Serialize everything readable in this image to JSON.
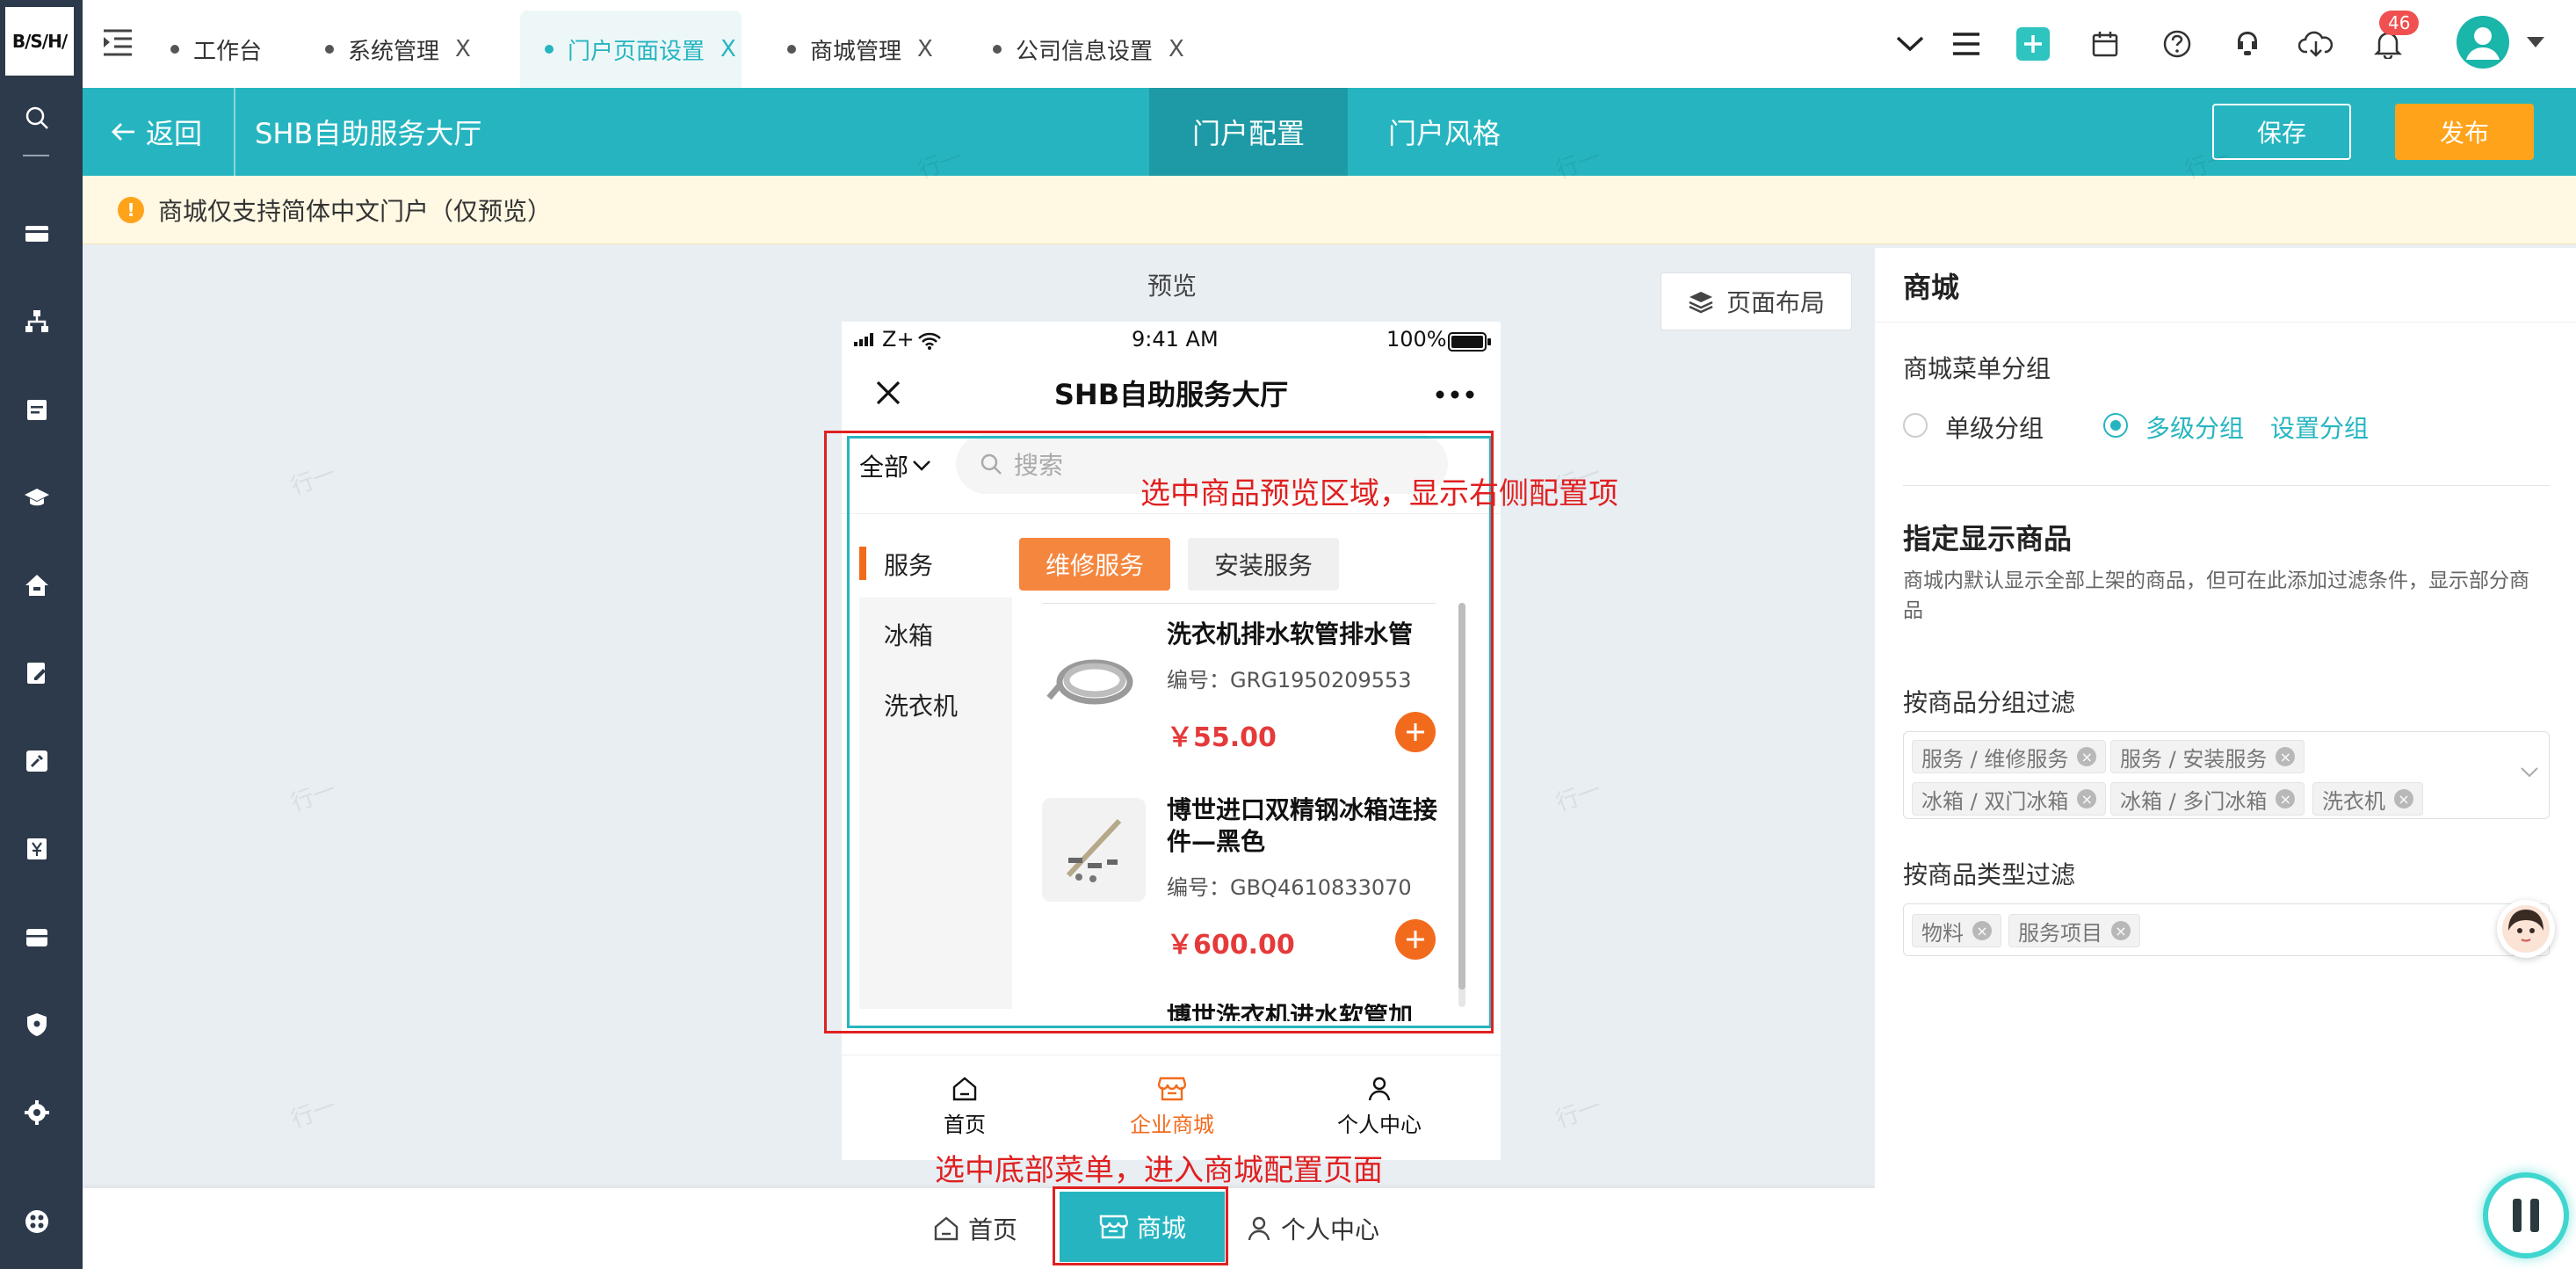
{
  "brand": {
    "logo_text": "B/S/H/"
  },
  "tabs": [
    {
      "label": "工作台",
      "closable": false,
      "active": false
    },
    {
      "label": "系统管理",
      "closable": true,
      "active": false
    },
    {
      "label": "门户页面设置",
      "closable": true,
      "active": true
    },
    {
      "label": "商城管理",
      "closable": true,
      "active": false
    },
    {
      "label": "公司信息设置",
      "closable": true,
      "active": false
    }
  ],
  "tab_close_glyph": "X",
  "topbar": {
    "notification_count": "46"
  },
  "header": {
    "back_label": "返回",
    "portal_name": "SHB自助服务大厅",
    "center_tabs": [
      "门户配置",
      "门户风格"
    ],
    "save_label": "保存",
    "publish_label": "发布"
  },
  "notice": {
    "text": "商城仅支持简体中文门户（仅预览）"
  },
  "preview": {
    "label": "预览",
    "layout_button": "页面布局",
    "status_bar": {
      "carrier": "Z+",
      "time": "9:41 AM",
      "battery": "100%"
    },
    "title": "SHB自助服务大厅",
    "category_all": "全部",
    "search_placeholder": "搜索",
    "side_menu": [
      "服务",
      "冰箱",
      "洗衣机"
    ],
    "pills": [
      "维修服务",
      "安装服务"
    ],
    "products": [
      {
        "name": "洗衣机排水软管排水管",
        "code": "编号：GRG1950209553",
        "price": "￥55.00"
      },
      {
        "name": "博世进口双精钢冰箱连接件—黑色",
        "code": "编号：GBQ4610833070",
        "price": "￥600.00"
      },
      {
        "name": "博世洗衣机进水软管加",
        "code": "",
        "price": ""
      }
    ],
    "tabbar": [
      "首页",
      "企业商城",
      "个人中心"
    ]
  },
  "annotations": {
    "goods_area": "选中商品预览区域，显示右侧配置项",
    "bottom_menu": "选中底部菜单，进入商城配置页面"
  },
  "bottom_menu": [
    "首页",
    "商城",
    "个人中心"
  ],
  "panel": {
    "title": "商城",
    "menu_group_label": "商城菜单分组",
    "radio_single": "单级分组",
    "radio_multi": "多级分组",
    "selected": "多级分组",
    "set_groups": "设置分组",
    "show_goods_title": "指定显示商品",
    "show_goods_desc": "商城内默认显示全部上架的商品，但可在此添加过滤条件，显示部分商品",
    "filter_group_label": "按商品分组过滤",
    "group_tags": [
      "服务 / 维修服务",
      "服务 / 安装服务",
      "冰箱 / 双门冰箱",
      "冰箱 / 多门冰箱",
      "洗衣机"
    ],
    "filter_type_label": "按商品类型过滤",
    "type_tags": [
      "物料",
      "服务项目"
    ]
  },
  "watermark": "行一",
  "colors": {
    "teal": "#26b5c0",
    "orange": "#f26b1d",
    "publish": "#ffa31a",
    "annotation_red": "#e02020",
    "rail": "#2d3a4b"
  },
  "icons": [
    "search-icon",
    "card-icon",
    "org-icon",
    "task-icon",
    "graduation-icon",
    "home-icon",
    "edit-icon",
    "tool-icon",
    "yen-icon",
    "store-icon",
    "shield-icon",
    "gear-icon",
    "apps-icon"
  ]
}
